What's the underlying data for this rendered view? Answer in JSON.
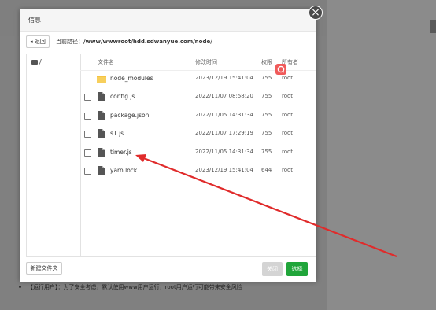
{
  "dialog": {
    "title": "信息",
    "close_glyph": "×",
    "back_label": "返回",
    "path_label": "当前路径：",
    "path_value": "/www/wwwroot/hdd.sdwanyue.com/node/",
    "tree_root": "/",
    "columns": {
      "name": "文件名",
      "mtime": "修改时间",
      "perm": "权限",
      "owner": "所有者"
    },
    "rows": [
      {
        "name": "node_modules",
        "mtime": "2023/12/19 15:41:04",
        "perm": "755",
        "owner": "root",
        "type": "folder",
        "has_checkbox": false
      },
      {
        "name": "config.js",
        "mtime": "2022/11/07 08:58:20",
        "perm": "755",
        "owner": "root",
        "type": "file",
        "has_checkbox": true
      },
      {
        "name": "package.json",
        "mtime": "2022/11/05 14:31:34",
        "perm": "755",
        "owner": "root",
        "type": "file",
        "has_checkbox": true
      },
      {
        "name": "s1.js",
        "mtime": "2022/11/07 17:29:19",
        "perm": "755",
        "owner": "root",
        "type": "file",
        "has_checkbox": true
      },
      {
        "name": "timer.js",
        "mtime": "2022/11/05 14:31:34",
        "perm": "755",
        "owner": "root",
        "type": "file",
        "has_checkbox": true
      },
      {
        "name": "yarn.lock",
        "mtime": "2023/12/19 15:41:04",
        "perm": "644",
        "owner": "root",
        "type": "file",
        "has_checkbox": true
      }
    ],
    "new_folder_label": "新建文件夹",
    "close_label": "关闭",
    "select_label": "选择"
  },
  "background": {
    "hint_text": "【运行用户】：为了安全考虑，默认使用www用户运行，root用户运行可能带来安全风险"
  },
  "colors": {
    "accent_green": "#20a53a",
    "arrow_red": "#e02b2b",
    "badge_red": "#f05a5a"
  }
}
